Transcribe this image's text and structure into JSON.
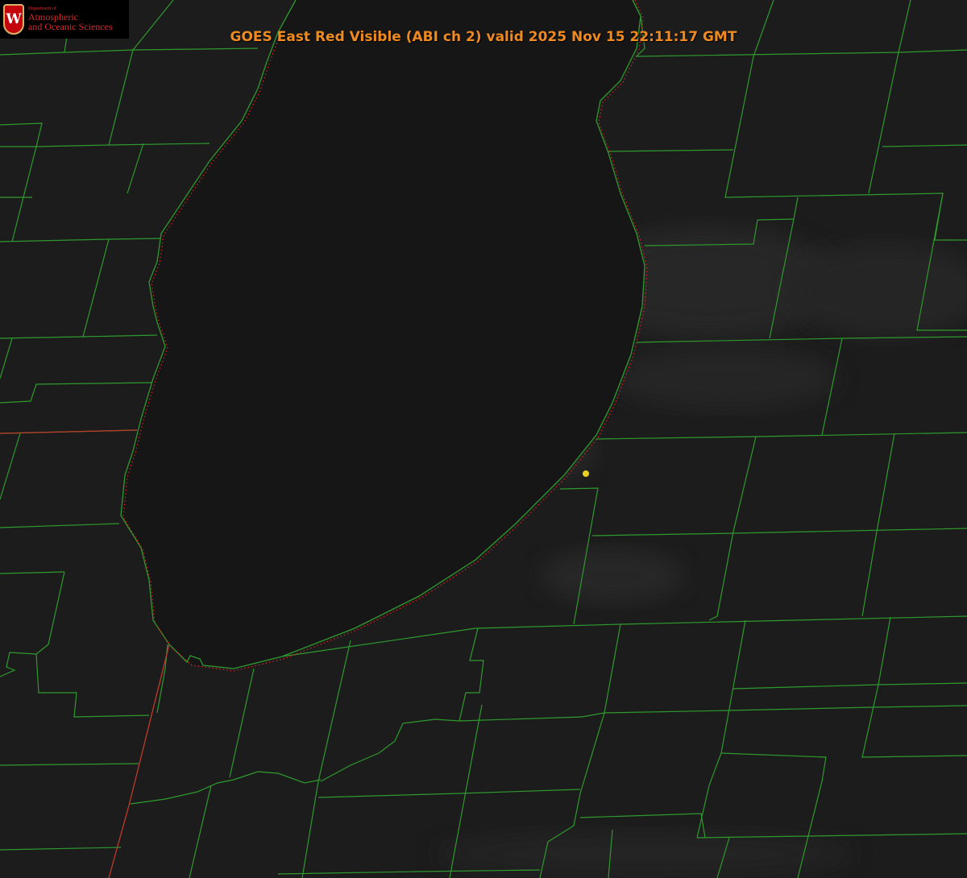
{
  "logo": {
    "department": "Department of",
    "line1": "Atmospheric",
    "line2": "and Oceanic Sciences",
    "crest_letter": "W"
  },
  "title": "GOES East Red Visible (ABI ch 2) valid 2025 Nov 15 22:11:17 GMT",
  "colors": {
    "background": "#1b1b1b",
    "lake": "#171717",
    "county_lines": "#2e9a2e",
    "state_line": "#c03a2a",
    "shoreline_dots": "#e02020",
    "marker": "#e8d020",
    "title": "#f08a1e"
  },
  "icons": {
    "marker": "station-dot-icon",
    "crest": "uw-crest-icon"
  }
}
